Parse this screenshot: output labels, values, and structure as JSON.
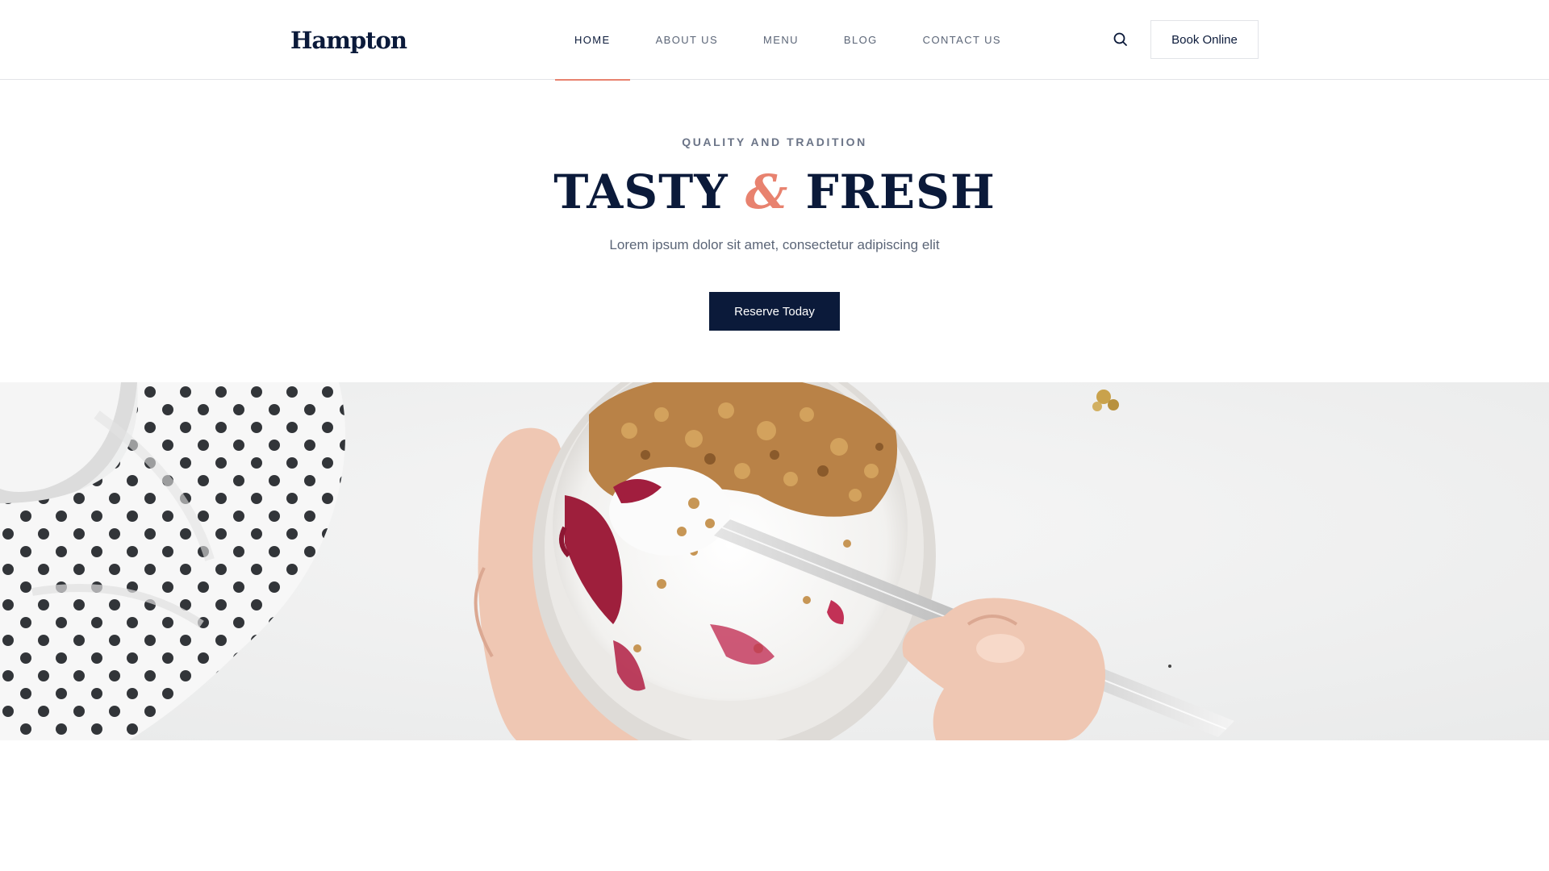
{
  "brand": {
    "logo": "Hampton"
  },
  "nav": {
    "items": [
      {
        "label": "HOME",
        "active": true
      },
      {
        "label": "ABOUT US",
        "active": false
      },
      {
        "label": "MENU",
        "active": false
      },
      {
        "label": "BLOG",
        "active": false
      },
      {
        "label": "CONTACT US",
        "active": false
      }
    ]
  },
  "header": {
    "search_icon": "search-icon",
    "book_label": "Book Online"
  },
  "hero": {
    "eyebrow": "QUALITY AND TRADITION",
    "headline_left": "TASTY",
    "headline_amp": "&",
    "headline_right": "FRESH",
    "subtitle": "Lorem ipsum dolor sit amet, consectetur adipiscing elit",
    "cta_label": "Reserve Today"
  },
  "colors": {
    "navy": "#0b1a3a",
    "accent": "#e8826f",
    "muted": "#5b6577"
  }
}
